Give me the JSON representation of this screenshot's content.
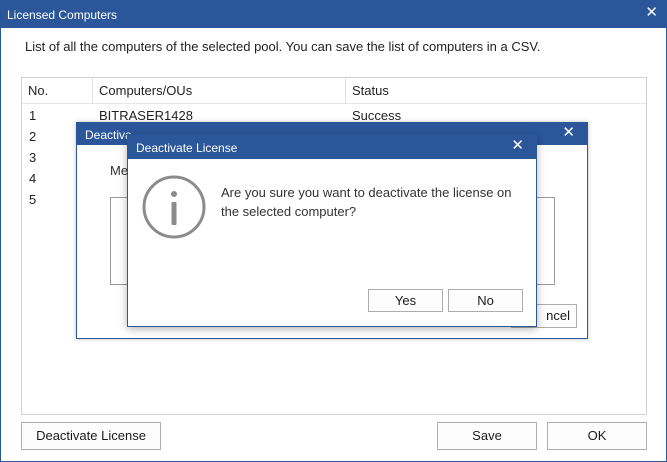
{
  "main_window": {
    "title": "Licensed Computers",
    "close_glyph": "✕",
    "description": "List of all the computers of the selected pool. You can save the list of computers in a CSV.",
    "table": {
      "columns": [
        "No.",
        "Computers/OUs",
        "Status"
      ],
      "rows": [
        {
          "no": "1",
          "computer": "BITRASER1428",
          "status": "Success"
        },
        {
          "no": "2",
          "computer": "",
          "status": ""
        },
        {
          "no": "3",
          "computer": "",
          "status": ""
        },
        {
          "no": "4",
          "computer": "",
          "status": ""
        },
        {
          "no": "5",
          "computer": "",
          "status": ""
        }
      ]
    },
    "buttons": {
      "deactivate": "Deactivate License",
      "save": "Save",
      "ok": "OK"
    }
  },
  "background_dialog": {
    "title": "Deactivate License",
    "title_visible": "Deactiva",
    "close_glyph": "✕",
    "label_visible": "Me",
    "cancel_visible": "ncel"
  },
  "confirm_dialog": {
    "title": "Deactivate License",
    "close_glyph": "✕",
    "icon": "info-icon",
    "message": "Are you sure you want to deactivate the license on the selected computer?",
    "yes": "Yes",
    "no": "No"
  },
  "colors": {
    "titlebar": "#2b579a",
    "border": "#adadad",
    "icon_gray": "#8c8c8c"
  }
}
